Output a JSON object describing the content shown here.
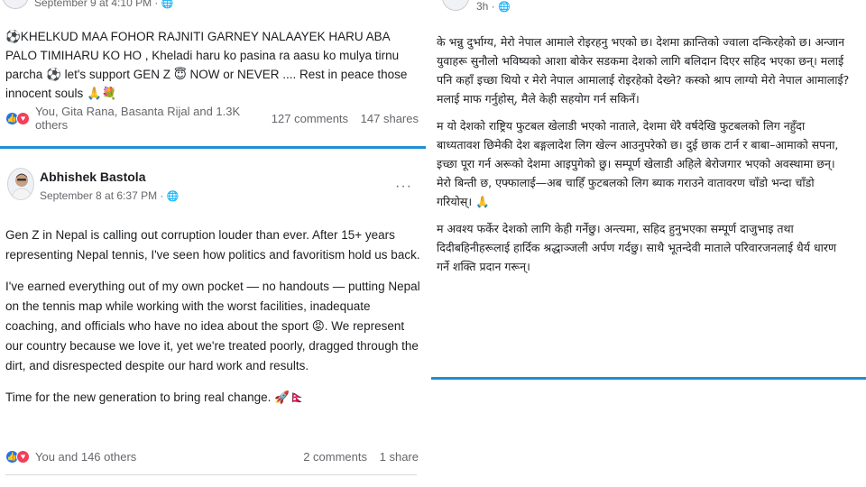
{
  "card1": {
    "date": "September 9 at 4:10 PM · ",
    "globe": "🌐",
    "text": "⚽KHELKUD MAA FOHOR RAJNITI GARNEY NALAAYEK HARU ABA PALO TIMIHARU KO HO , Kheladi haru ko pasina ra aasu ko mulya tirnu parcha ⚽ let's support GEN Z 😇 NOW or NEVER .... Rest in peace those innocent souls 🙏💐",
    "reactions": "You, Gita Rana, Basanta Rijal and 1.3K others",
    "comments": "127 comments",
    "shares": "147 shares"
  },
  "card2": {
    "author": "Abhishek Bastola",
    "date": "September 8 at 6:37 PM · ",
    "globe": "🌐",
    "more": "···",
    "paragraphs": [
      "Gen Z in Nepal is calling out corruption louder than ever. After 15+ years representing Nepal tennis, I've seen how politics and favoritism hold us back.",
      "I've earned everything out of my own pocket — no handouts — putting Nepal on the tennis map while working with the worst facilities, inadequate coaching, and officials who have no idea about the sport 😡. We represent our country because we love it, yet we're treated poorly, dragged through the dirt, and disrespected despite our hard work and results.",
      "Time for the new generation to bring real change. 🚀🇳🇵"
    ],
    "reactions": "You and 146 others",
    "comments": "2 comments",
    "shares": "1 share"
  },
  "card3": {
    "date": "3h · ",
    "globe": "🌐",
    "paragraphs": [
      "के भन्नु दुर्भाग्य, मेरो नेपाल आमाले रोइरहनु भएको छ। देशमा क्रान्तिको ज्वाला दन्किरहेको छ। अन्जान युवाहरू सुनौलो भविष्यको आशा बोकेर सडकमा देशको लागि बलिदान दिएर सहिद भएका छन्। मलाई पनि कहाँ इच्छा थियो र मेरो नेपाल आमालाई रोइरहेको देख्ने? कस्को श्राप लाग्यो मेरो नेपाल आमालाई? मलाई माफ गर्नुहोस्, मैले केही सहयोग गर्न सकिनँ।",
      "म यो देशको राष्ट्रिय फुटबल खेलाडी भएको नाताले, देशमा धेरै वर्षदेखि फुटबलको लिग नहुँदा बाध्यतावश छिमेकी देश बङ्गलादेश  लिग खेल्न आउनुपरेको छ। दुई छाक टार्न र बाबा–आमाको सपना, इच्छा पूरा गर्न अरूको देशमा आइपुगेको छु। सम्पूर्ण खेलाडी अहिले बेरोजगार भएको अवस्थामा छन्।\nमेरो बिन्ती छ, एफ्फालाई—अब चाहिँ फुटबलको लिग ब्याक गराउने वातावरण चाँडो भन्दा चाँडो गरियोस्। 🙏",
      "म अवश्य फर्केर देशको लागि केही गर्नेछु। अन्त्यमा, सहिद हुनुभएका सम्पूर्ण दाजुभाइ तथा दिदीबहिनीहरूलाई हार्दिक श्रद्धाञ्जली अर्पण गर्दछु। साथै भूतन्देवी माताले परिवारजनलाई धैर्य धारण गर्ने शक्ति प्रदान गरून्।"
    ]
  },
  "colors": {
    "divider": "#1d8fd3",
    "like": "#1877f2",
    "love": "#f33e58",
    "muted": "#65676b"
  }
}
